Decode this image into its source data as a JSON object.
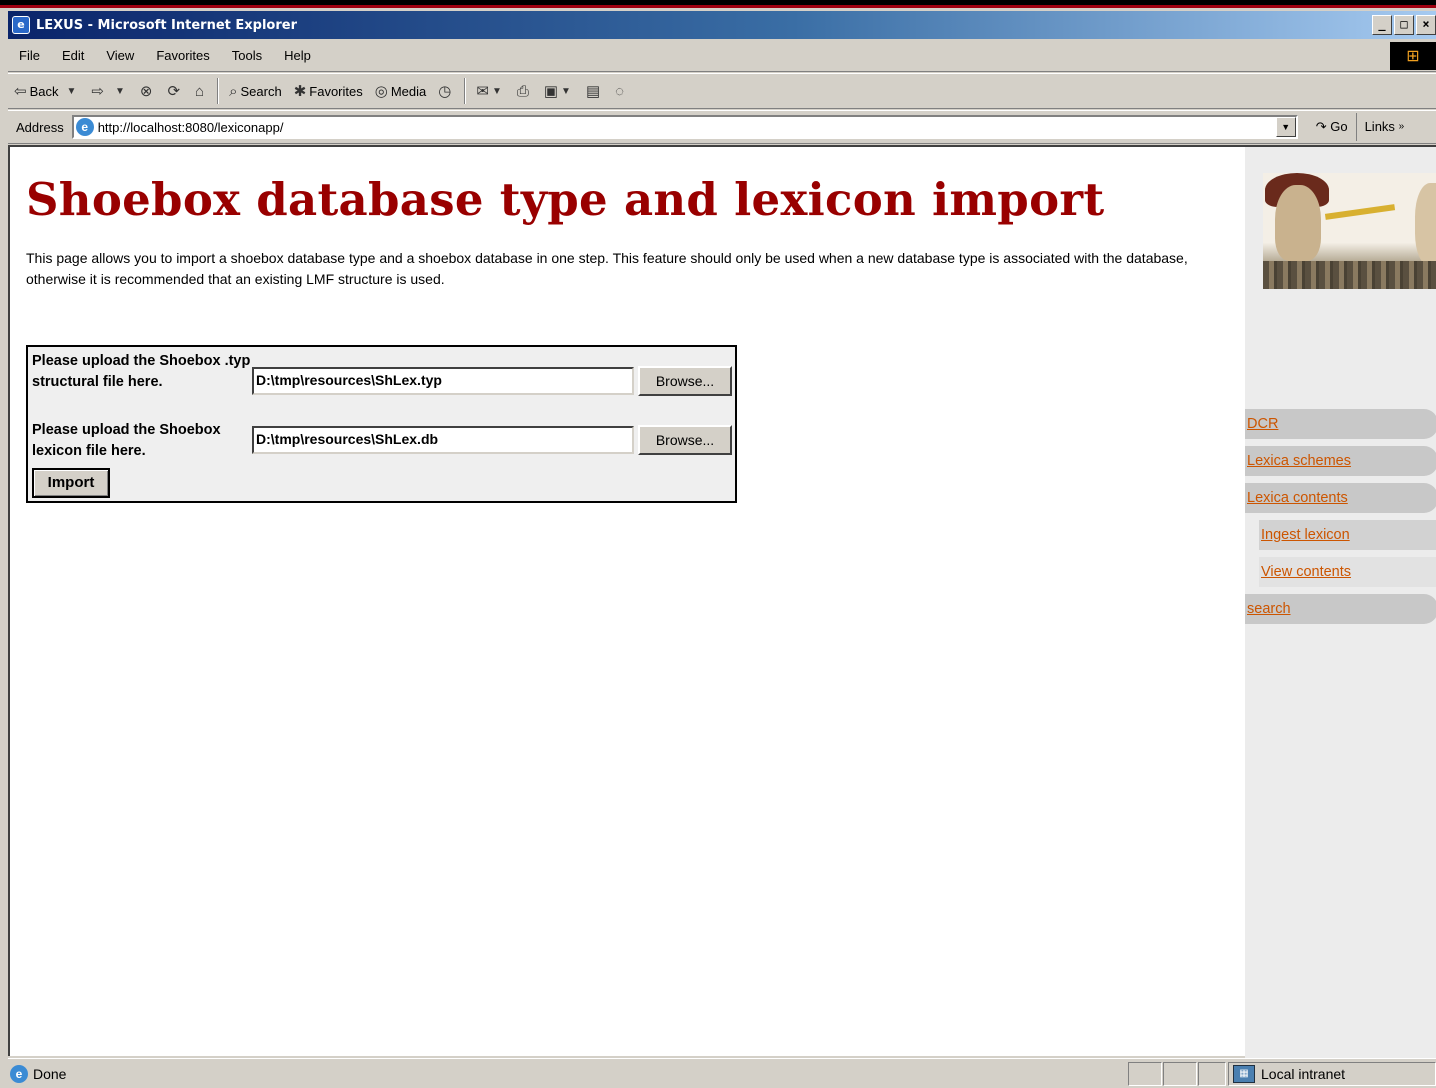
{
  "window": {
    "title": "LEXUS - Microsoft Internet Explorer",
    "buttons": {
      "minimize": "_",
      "maximize": "□",
      "close": "×"
    }
  },
  "menu": [
    "File",
    "Edit",
    "View",
    "Favorites",
    "Tools",
    "Help"
  ],
  "toolbar": {
    "back": "Back",
    "search": "Search",
    "favorites": "Favorites",
    "media": "Media"
  },
  "address": {
    "label": "Address",
    "url": "http://localhost:8080/lexiconapp/",
    "go": "Go",
    "links": "Links"
  },
  "page": {
    "title": "Shoebox database type and lexicon import",
    "description": "This page allows you to import a shoebox database type and a shoebox database in one step. This feature should only be used when a new database type is associated with the database, otherwise it is recommended that an existing LMF structure is used.",
    "form": {
      "typ_label": "Please upload the Shoebox .typ structural file here.",
      "typ_value": "D:\\tmp\\resources\\ShLex.typ",
      "db_label": "Please upload the Shoebox lexicon file here.",
      "db_value": "D:\\tmp\\resources\\ShLex.db",
      "browse_label": "Browse...",
      "import_label": "Import"
    }
  },
  "sidebar": {
    "items": [
      {
        "label": "DCR"
      },
      {
        "label": "Lexica schemes"
      },
      {
        "label": "Lexica contents"
      },
      {
        "label": "Ingest lexicon"
      },
      {
        "label": "View contents"
      },
      {
        "label": "search"
      }
    ]
  },
  "status": {
    "text": "Done",
    "zone": "Local intranet"
  },
  "colors": {
    "heading": "#990000",
    "link": "#cc5500",
    "titlebar_start": "#0a246a",
    "titlebar_end": "#a6caf0"
  }
}
